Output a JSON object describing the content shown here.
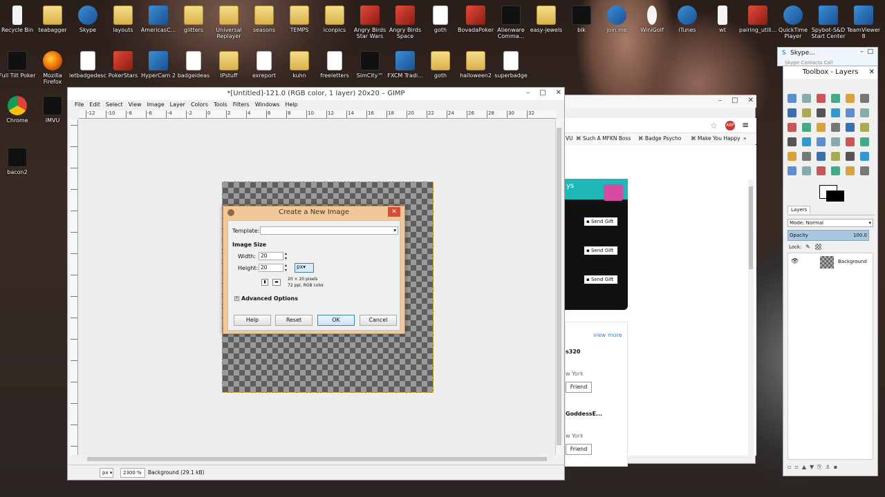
{
  "desktop": {
    "icons": [
      {
        "label": "Recycle Bin",
        "icon": "recycle-bin-icon"
      },
      {
        "label": "teabagger",
        "icon": "folder-icon"
      },
      {
        "label": "Skype",
        "icon": "skype-icon"
      },
      {
        "label": "layouts",
        "icon": "folder-icon"
      },
      {
        "label": "AmericasC...",
        "icon": "americas-card-room-icon"
      },
      {
        "label": "glitters",
        "icon": "folder-icon"
      },
      {
        "label": "Universal Replayer",
        "icon": "universal-replayer-icon"
      },
      {
        "label": "seasons",
        "icon": "folder-icon"
      },
      {
        "label": "TEMPS",
        "icon": "folder-icon"
      },
      {
        "label": "iconpics",
        "icon": "folder-icon"
      },
      {
        "label": "Angry Birds Star Wars",
        "icon": "angry-birds-star-wars-icon"
      },
      {
        "label": "Angry Birds Space",
        "icon": "angry-birds-space-icon"
      },
      {
        "label": "goth",
        "icon": "file-icon"
      },
      {
        "label": "BovadaPoker",
        "icon": "bovada-poker-icon"
      },
      {
        "label": "Alienware Comma...",
        "icon": "alienware-icon"
      },
      {
        "label": "easy-jewels",
        "icon": "folder-icon"
      },
      {
        "label": "blk",
        "icon": "black-image-icon"
      },
      {
        "label": "join.me",
        "icon": "join-me-icon"
      },
      {
        "label": "WiniGolf",
        "icon": "golf-ball-icon"
      },
      {
        "label": "iTunes",
        "icon": "itunes-icon"
      },
      {
        "label": "wt",
        "icon": "white-image-icon"
      },
      {
        "label": "pairing_utili...",
        "icon": "archive-icon"
      },
      {
        "label": "QuickTime Player",
        "icon": "quicktime-icon"
      },
      {
        "label": "Spybot-S&D Start Center",
        "icon": "spybot-icon"
      },
      {
        "label": "TeamViewer 8",
        "icon": "teamviewer-icon"
      },
      {
        "label": "Full Tilt Poker",
        "icon": "full-tilt-poker-icon"
      },
      {
        "label": "Mozilla Firefox",
        "icon": "firefox-icon"
      },
      {
        "label": "letbadgedesc",
        "icon": "file-icon"
      },
      {
        "label": "PokerStars",
        "icon": "pokerstars-icon"
      },
      {
        "label": "HyperCam 2",
        "icon": "hypercam-icon"
      },
      {
        "label": "badgeideas",
        "icon": "file-icon"
      },
      {
        "label": "IPstuff",
        "icon": "folder-icon"
      },
      {
        "label": "exreport",
        "icon": "file-icon"
      },
      {
        "label": "kuhn",
        "icon": "folder-icon"
      },
      {
        "label": "freeletters",
        "icon": "file-icon"
      },
      {
        "label": "SimCity™",
        "icon": "simcity-icon"
      },
      {
        "label": "FXCM Tradi...",
        "icon": "fxcm-icon"
      },
      {
        "label": "goth",
        "icon": "folder-icon"
      },
      {
        "label": "halloween2",
        "icon": "folder-icon"
      },
      {
        "label": "superbadge",
        "icon": "file-icon"
      },
      {
        "label": "Chrome",
        "icon": "chrome-icon"
      },
      {
        "label": "IMVU",
        "icon": "imvu-icon"
      },
      {
        "label": "bacon2",
        "icon": "bacon-image-icon"
      }
    ]
  },
  "gimp": {
    "title": "*[Untitled]-121.0 (RGB color, 1 layer) 20x20 – GIMP",
    "menu": [
      "File",
      "Edit",
      "Select",
      "View",
      "Image",
      "Layer",
      "Colors",
      "Tools",
      "Filters",
      "Windows",
      "Help"
    ],
    "ruler_ticks": [
      "-12",
      "-10",
      "-8",
      "-6",
      "-4",
      "-2",
      "0",
      "2",
      "4",
      "6",
      "8",
      "10",
      "12",
      "14",
      "16",
      "18",
      "20",
      "22",
      "24",
      "26",
      "28",
      "30",
      "32"
    ],
    "status": {
      "unit": "px",
      "zoom": "2300 %",
      "layer_info": "Background (29.1 kB)"
    }
  },
  "dialog": {
    "title": "Create a New Image",
    "template_label": "Template:",
    "template_value": "",
    "image_size_label": "Image Size",
    "width_label": "Width:",
    "width_value": "20",
    "height_label": "Height:",
    "height_value": "20",
    "unit": "px",
    "info_line1": "20 × 20 pixels",
    "info_line2": "72 ppi, RGB color",
    "advanced_label": "Advanced Options",
    "buttons": {
      "help": "Help",
      "reset": "Reset",
      "ok": "OK",
      "cancel": "Cancel"
    }
  },
  "chrome": {
    "bookmarks": [
      "VU",
      "Such A MFKN Boss",
      "Badge Psycho",
      "Make You Happy"
    ],
    "header_fragment": "ys",
    "send_gift": "Send Gift",
    "view_more": "view more",
    "people": [
      {
        "name": "s320",
        "location": "w York",
        "button": "Friend"
      },
      {
        "name": "GoddessE...",
        "location": "w York",
        "button": "Friend"
      }
    ]
  },
  "skype_window": {
    "title": "Skype...",
    "tabs": "Skype  Contacts  Call"
  },
  "toolbox": {
    "title": "Toolbox - Layers",
    "layers_tab": "Layers",
    "mode_label": "Mode: Normal",
    "opacity_label": "Opacity",
    "opacity_value": "100.0",
    "lock_label": "Lock:",
    "layer_name": "Background"
  },
  "colors": {
    "accent": "#3c7fb1",
    "dialog_frame": "#f0c89a",
    "close_red": "#d94b3b"
  }
}
